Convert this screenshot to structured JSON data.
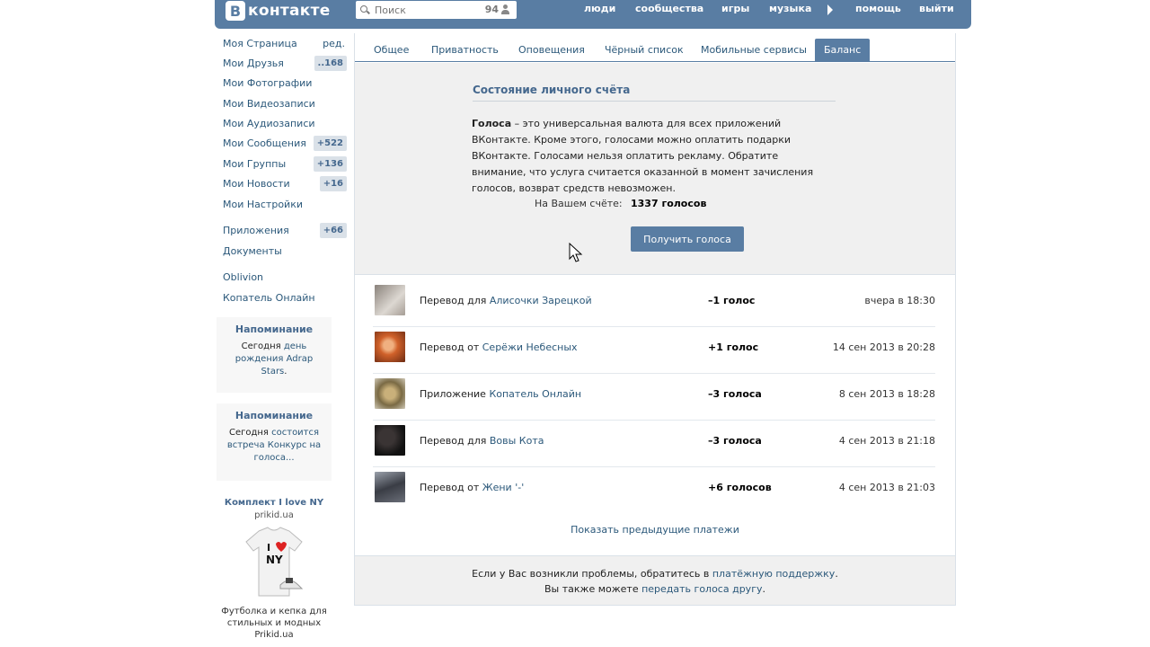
{
  "header": {
    "logo_letter": "B",
    "logo_text": "контакте",
    "search": {
      "placeholder": "Поиск",
      "count": "94"
    },
    "nav": [
      "люди",
      "сообщества",
      "игры",
      "музыка",
      "помощь",
      "выйти"
    ]
  },
  "sidebar": {
    "items": [
      {
        "label": "Моя Страница",
        "right": "ред."
      },
      {
        "label": "Мои Друзья",
        "badge": "..168"
      },
      {
        "label": "Мои Фотографии"
      },
      {
        "label": "Мои Видеозаписи"
      },
      {
        "label": "Мои Аудиозаписи"
      },
      {
        "label": "Мои Сообщения",
        "badge": "+522"
      },
      {
        "label": "Мои Группы",
        "badge": "+136"
      },
      {
        "label": "Мои Новости",
        "badge": "+16"
      },
      {
        "label": "Мои Настройки"
      },
      {
        "label": "Приложения",
        "badge": "+66"
      },
      {
        "label": "Документы"
      },
      {
        "label": "Oblivion"
      },
      {
        "label": "Копатель Онлайн"
      }
    ],
    "reminders": [
      {
        "title": "Напоминание",
        "pre": "Сегодня ",
        "b1": "день рождения",
        "mid": " ",
        "link": "Adrap Stars",
        "post": "."
      },
      {
        "title": "Напоминание",
        "pre": "Сегодня ",
        "b1": "состоится встреча",
        "mid": " ",
        "link": "Конкурс на голоса...",
        "post": ""
      }
    ],
    "ad": {
      "title": "Комплект I love NY",
      "site": "prikid.ua",
      "text": "Футболка и кепка для стильных и модных Prikid.ua"
    }
  },
  "tabs": [
    {
      "label": "Общее"
    },
    {
      "label": "Приватность"
    },
    {
      "label": "Оповещения"
    },
    {
      "label": "Чёрный список"
    },
    {
      "label": "Мобильные сервисы"
    },
    {
      "label": "Баланс",
      "active": true
    }
  ],
  "balance": {
    "title": "Состояние личного счёта",
    "desc_bold": "Голоса",
    "desc_rest": " – это универсальная валюта для всех приложений ВКонтакте. Кроме этого, голосами можно оплатить подарки ВКонтакте. Голосами нельзя оплатить рекламу. Обратите внимание, что услуга считается оказанной в момент зачисления голосов, возврат средств невозможен.",
    "label": "На Вашем счёте:",
    "value": "1337 голосов",
    "button": "Получить голоса"
  },
  "transactions": [
    {
      "prefix": "Перевод для ",
      "name": "Алисочки Зарецкой",
      "amount": "–1 голос",
      "date": "вчера в 18:30",
      "avatar_color": "#b9b0a8"
    },
    {
      "prefix": "Перевод от ",
      "name": "Серёжи Небесных",
      "amount": "+1 голос",
      "date": "14 сен 2013 в 20:28",
      "avatar_color": "#c86a2e"
    },
    {
      "prefix": "Приложение ",
      "name": "Копатель Онлайн",
      "amount": "–3 голоса",
      "date": "8 сен 2013 в 18:28",
      "avatar_color": "#9a8a5e"
    },
    {
      "prefix": "Перевод для ",
      "name": "Вовы Кота",
      "amount": "–3 голоса",
      "date": "4 сен 2013 в 21:18",
      "avatar_color": "#2a2626"
    },
    {
      "prefix": "Перевод от ",
      "name": "Жени '-'",
      "amount": "+6 голосов",
      "date": "4 сен 2013 в 21:03",
      "avatar_color": "#4a4d55"
    }
  ],
  "more_link": "Показать предыдущие платежи",
  "footer": {
    "line1_pre": "Если у Вас возникли проблемы, обратитесь в ",
    "line1_link": "платёжную поддержку",
    "line1_post": ".",
    "line2_pre": "Вы также можете ",
    "line2_link": "передать голоса другу",
    "line2_post": "."
  }
}
